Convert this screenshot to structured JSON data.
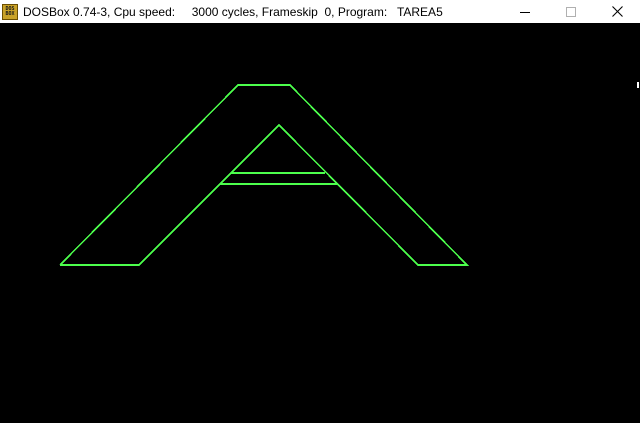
{
  "window": {
    "title": "DOSBox 0.74-3, Cpu speed:     3000 cycles, Frameskip  0, Program:   TAREA5",
    "icon_text_top": "DOS",
    "icon_text_bottom": "BOX",
    "icon": "dosbox-icon",
    "controls": {
      "minimize": "minimize-icon",
      "maximize": "maximize-icon",
      "close": "close-icon"
    }
  },
  "screen": {
    "background": "#000000",
    "drawing": {
      "shape": "letter A outline",
      "stroke_color": "#4cff4c"
    }
  }
}
